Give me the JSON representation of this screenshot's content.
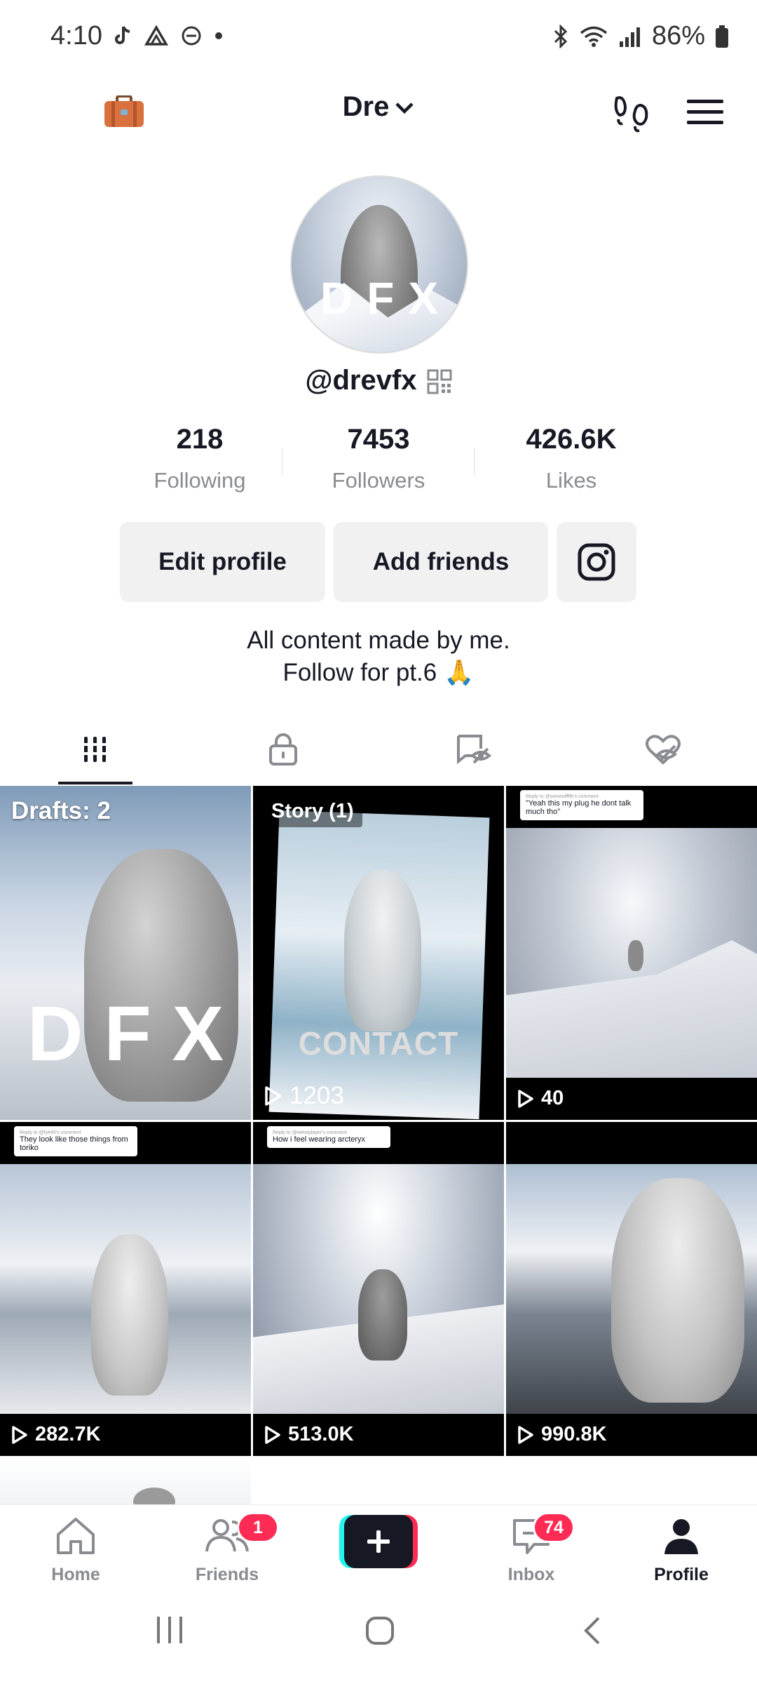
{
  "status": {
    "time": "4:10",
    "battery": "86%"
  },
  "header": {
    "account": "Dre"
  },
  "profile": {
    "avatar_logo": "DFX",
    "username": "@drevfx",
    "stats": [
      {
        "value": "218",
        "label": "Following"
      },
      {
        "value": "7453",
        "label": "Followers"
      },
      {
        "value": "426.6K",
        "label": "Likes"
      }
    ],
    "buttons": {
      "edit": "Edit profile",
      "add": "Add friends"
    },
    "bio_line1": "All content made by me.",
    "bio_line2": "Follow for pt.6 🙏"
  },
  "grid": {
    "tiles": [
      {
        "tag": "Drafts: 2",
        "logo": "DFX"
      },
      {
        "tag": "Story (1)",
        "caption": "CONTACT",
        "views": "1203"
      },
      {
        "reply_sub": "Reply to @somewfffth's comment",
        "reply": "\"Yeah this my plug he dont talk much tho\"",
        "views": "40"
      },
      {
        "reply_sub": "Reply to @fy#45's comment",
        "reply": "They look like those things from toriko",
        "views": "282.7K"
      },
      {
        "reply_sub": "Reply to @wetxtplayer's comment",
        "reply": "How i feel wearing arcteryx",
        "views": "513.0K"
      },
      {
        "views": "990.8K"
      }
    ]
  },
  "nav": {
    "home": "Home",
    "friends": "Friends",
    "friends_badge": "1",
    "inbox": "Inbox",
    "inbox_badge": "74",
    "profile": "Profile"
  }
}
